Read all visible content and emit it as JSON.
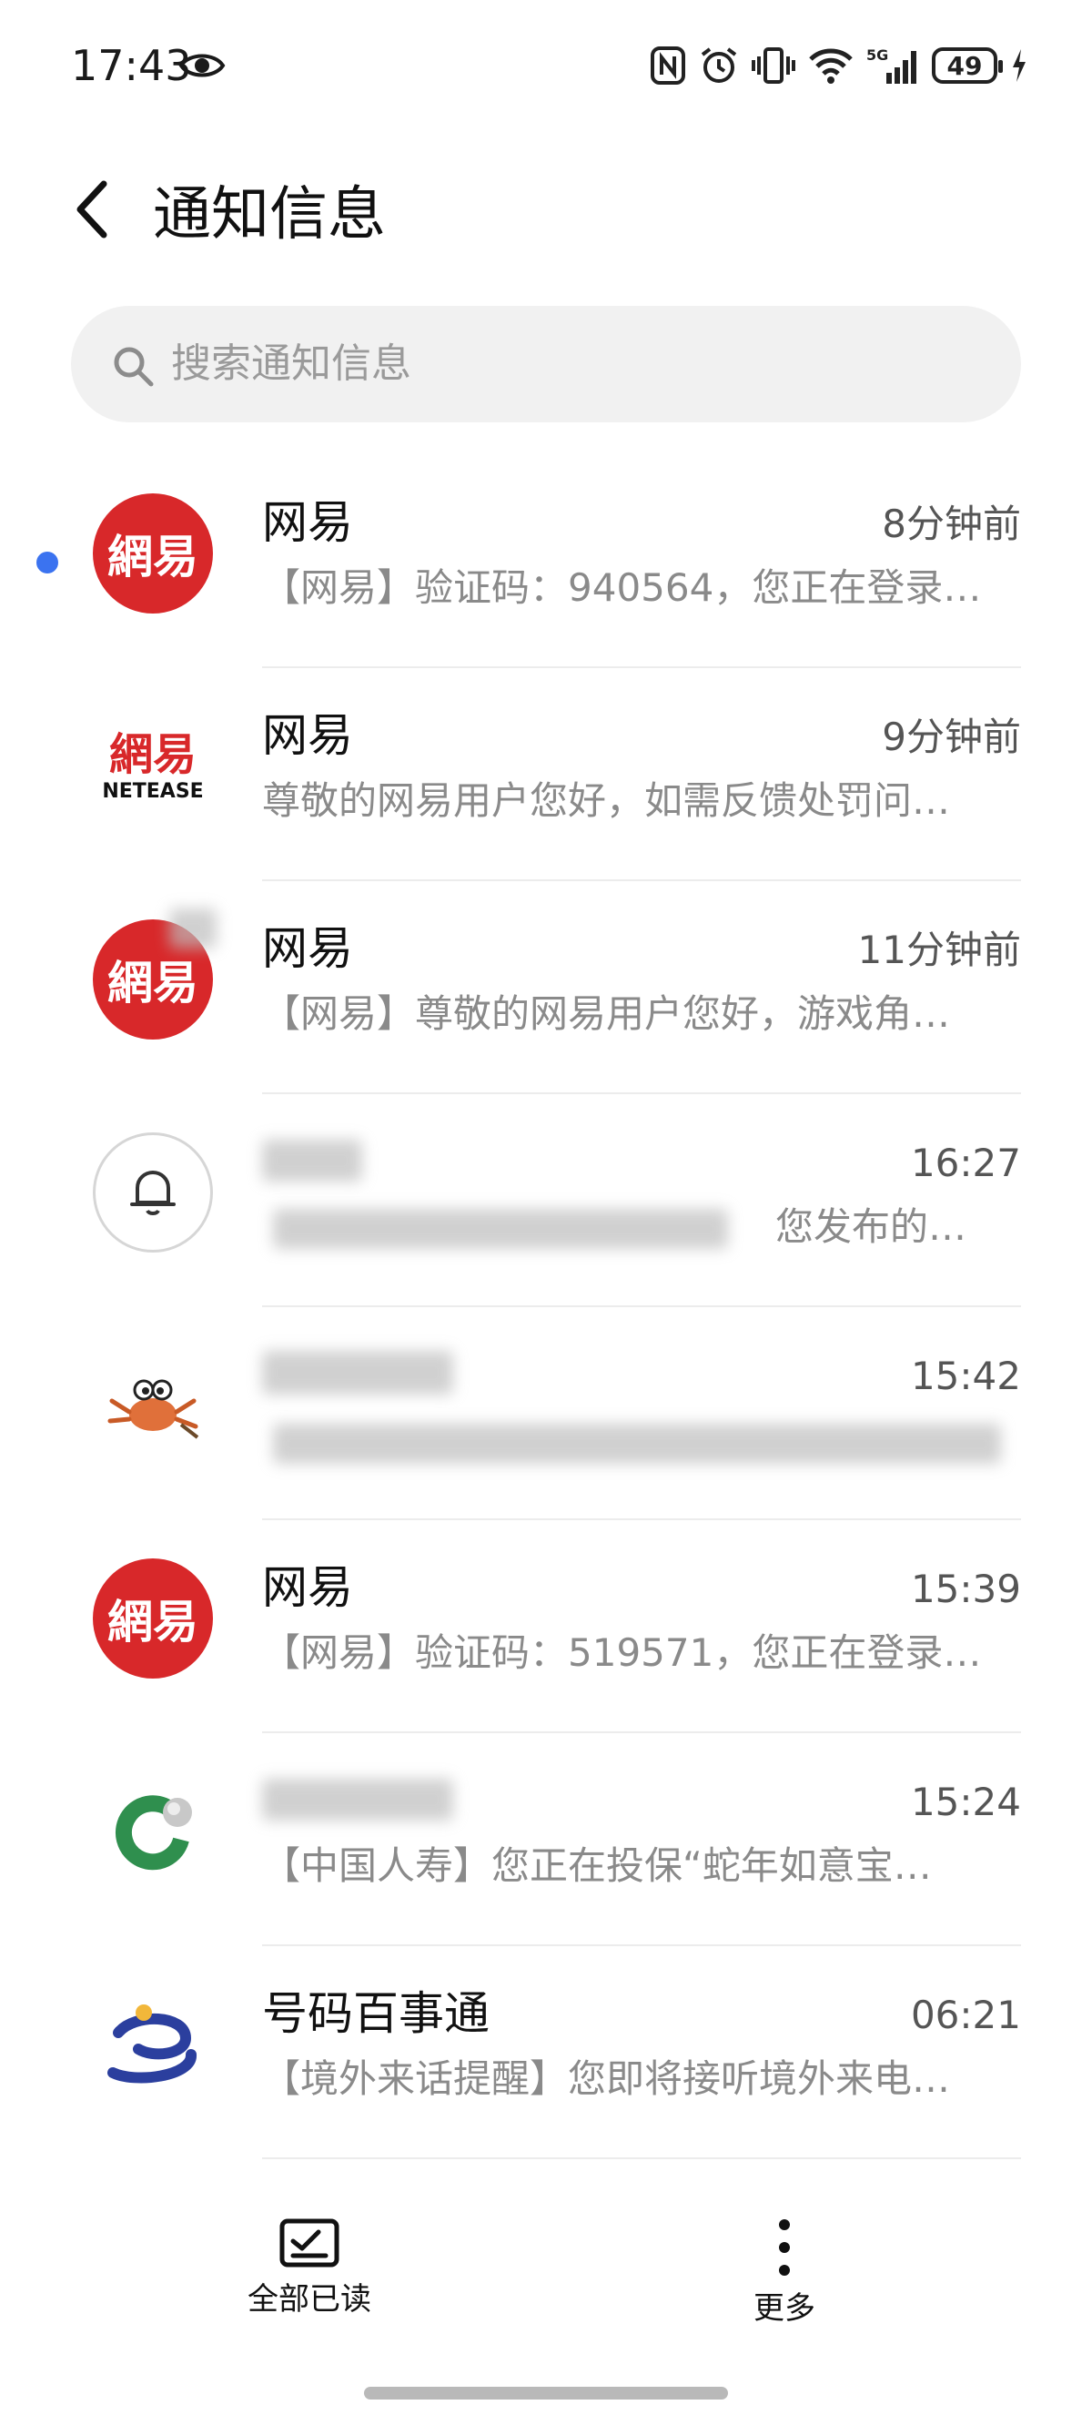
{
  "status_bar": {
    "time": "17:43",
    "battery_level": "49",
    "icons": [
      "eye-icon",
      "nfc-icon",
      "alarm-icon",
      "vibrate-icon",
      "wifi-icon",
      "signal-5g-icon",
      "battery-icon",
      "charging-icon"
    ]
  },
  "header": {
    "title": "通知信息",
    "back_icon": "chevron-left-icon"
  },
  "search": {
    "placeholder": "搜索通知信息"
  },
  "notifications": [
    {
      "title": "网易",
      "time": "8分钟前",
      "preview": "【网易】验证码：940564，您正在登录…",
      "avatar": "netease-red",
      "unread": true
    },
    {
      "title": "网易",
      "time": "9分钟前",
      "preview": "尊敬的网易用户您好，如需反馈处罚问…",
      "avatar": "netease-logo",
      "unread": false
    },
    {
      "title": "网易",
      "time": "11分钟前",
      "preview": "【网易】尊敬的网易用户您好，游戏角…",
      "avatar": "netease-red",
      "unread": false
    },
    {
      "title": "",
      "time": "16:27",
      "preview": "您发布的…",
      "avatar": "bell-icon",
      "unread": false
    },
    {
      "title": "",
      "time": "15:42",
      "preview": "",
      "avatar": "crab-icon",
      "unread": false
    },
    {
      "title": "网易",
      "time": "15:39",
      "preview": "【网易】验证码：519571，您正在登录…",
      "avatar": "netease-red",
      "unread": false
    },
    {
      "title": "",
      "time": "15:24",
      "preview": "【中国人寿】您正在投保“蛇年如意宝…",
      "avatar": "china-life-icon",
      "unread": false
    },
    {
      "title": "号码百事通",
      "time": "06:21",
      "preview": "【境外来话提醒】您即将接听境外来电…",
      "avatar": "baishitong-icon",
      "unread": false
    }
  ],
  "avatar_text": {
    "netease_cn": "網易",
    "netease_en": "NETEASE"
  },
  "bottom_bar": {
    "mark_all_read_label": "全部已读",
    "more_label": "更多"
  },
  "colors": {
    "unread_dot": "#3b73f0",
    "netease_red": "#d8282a",
    "china_life_green": "#2f8f4e",
    "baishitong_blue": "#2b3f9e"
  }
}
